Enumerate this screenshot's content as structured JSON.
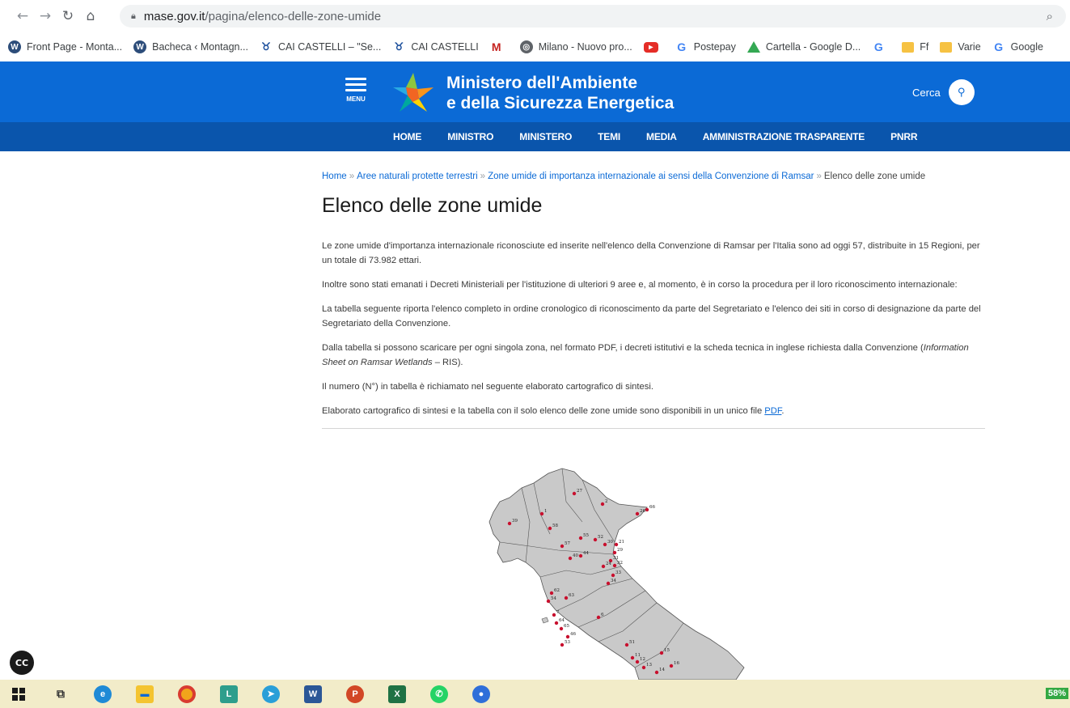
{
  "browser": {
    "url_host": "mase.gov.it",
    "url_path": "/pagina/elenco-delle-zone-umide",
    "bookmarks": [
      {
        "label": "Front Page - Monta...",
        "icon": "wordpress-icon"
      },
      {
        "label": "Bacheca ‹ Montagn...",
        "icon": "wordpress-icon"
      },
      {
        "label": "CAI CASTELLI – \"Se...",
        "icon": "cai-icon"
      },
      {
        "label": "CAI CASTELLI",
        "icon": "cai-icon"
      },
      {
        "label": "",
        "icon": "gmail-icon"
      },
      {
        "label": "Milano - Nuovo pro...",
        "icon": "chrome-icon"
      },
      {
        "label": "",
        "icon": "youtube-icon"
      },
      {
        "label": "Postepay",
        "icon": "google-icon"
      },
      {
        "label": "Cartella - Google D...",
        "icon": "drive-icon"
      },
      {
        "label": "",
        "icon": "google-icon"
      },
      {
        "label": "Ff",
        "icon": "folder-icon"
      },
      {
        "label": "Varie",
        "icon": "folder-icon"
      },
      {
        "label": "Google",
        "icon": "google-icon"
      }
    ]
  },
  "header": {
    "menu_label": "MENU",
    "title_line1": "Ministero dell'Ambiente",
    "title_line2": "e della Sicurezza Energetica",
    "search_label": "Cerca",
    "nav": [
      "HOME",
      "MINISTRO",
      "MINISTERO",
      "TEMI",
      "MEDIA",
      "AMMINISTRAZIONE TRASPARENTE",
      "PNRR"
    ]
  },
  "breadcrumb": {
    "items": [
      "Home",
      "Aree naturali protette terrestri",
      "Zone umide di importanza internazionale ai sensi della Convenzione di Ramsar"
    ],
    "separator": "»",
    "current": "Elenco delle zone umide"
  },
  "page": {
    "title": "Elenco delle zone umide",
    "para1": "Le zone umide d'importanza internazionale riconosciute ed inserite nell'elenco della Convenzione di Ramsar per l'Italia sono ad oggi 57, distribuite in 15 Regioni, per un totale di 73.982 ettari.",
    "para2": "Inoltre sono stati emanati i Decreti Ministeriali per l'istituzione di ulteriori 9 aree e, al momento, è in corso la procedura per il loro riconoscimento internazionale:",
    "para3": "La tabella seguente riporta l'elenco completo in ordine cronologico di riconoscimento da parte del Segretariato e l'elenco dei siti in corso di designazione da parte del Segretariato della Convenzione.",
    "para4_start": "Dalla tabella si possono scaricare per ogni singola zona, nel formato PDF, i decreti istitutivi e la scheda tecnica in inglese richiesta dalla Convenzione (",
    "para4_italic": "Information Sheet on Ramsar Wetlands",
    "para4_end": " – RIS).",
    "para5": "Il numero (N°) in tabella è richiamato nel seguente elaborato cartografico di sintesi.",
    "para6_start": "Elaborato cartografico di sintesi e la tabella con il solo elenco delle zone umide sono disponibili in un unico file ",
    "para6_link": "PDF",
    "para6_end": "."
  },
  "map": {
    "labels": [
      "27",
      "2",
      "66",
      "1",
      "39",
      "26",
      "58",
      "55",
      "52",
      "30",
      "57",
      "21",
      "40",
      "44",
      "29",
      "31",
      "24",
      "32",
      "33",
      "34",
      "62",
      "63",
      "54",
      "7",
      "64",
      "65",
      "46",
      "53",
      "6",
      "51",
      "11",
      "12",
      "13",
      "14",
      "15",
      "16"
    ]
  },
  "taskbar": {
    "battery": "58%"
  },
  "colors": {
    "header_blue": "#0b6ad6",
    "nav_blue": "#0a55ac",
    "link_blue": "#0b6ad6",
    "map_gray": "#c9c9c9",
    "map_dot": "#c8102e"
  }
}
